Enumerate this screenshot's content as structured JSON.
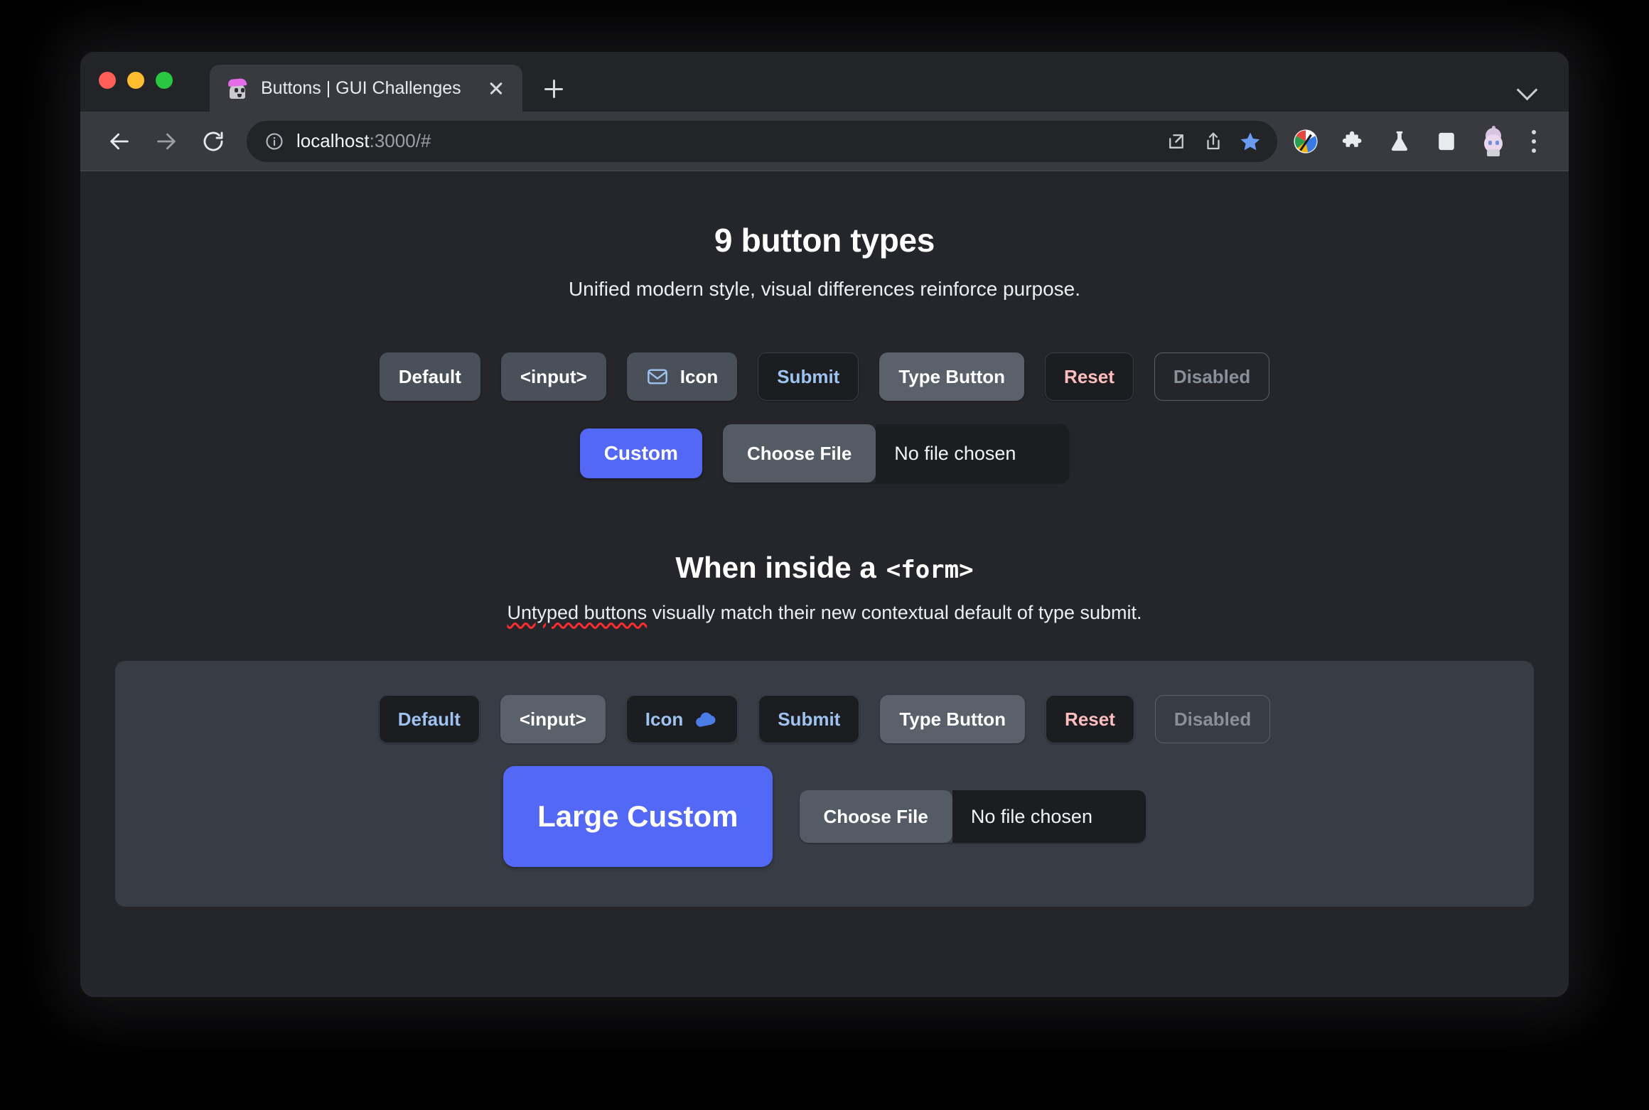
{
  "browser": {
    "tab": {
      "title": "Buttons | GUI Challenges",
      "favicon_name": "ghost-favicon"
    },
    "omnibox": {
      "url_main": "localhost",
      "url_dim": ":3000/#",
      "site_info_icon": "info-circle-icon"
    },
    "toolbar_icons": [
      "back-icon",
      "forward-icon",
      "reload-icon",
      "open-in-new-icon",
      "share-icon",
      "bookmark-star-icon",
      "color-palette-extension-icon",
      "puzzle-extensions-icon",
      "flask-labs-icon",
      "side-panel-icon",
      "profile-avatar-icon",
      "three-dot-menu-icon"
    ],
    "new_tab_label": "+",
    "close_tab_label": "×"
  },
  "page": {
    "title": "9 button types",
    "subtitle": "Unified modern style, visual differences reinforce purpose.",
    "row1": [
      {
        "label": "Default",
        "variant": "default"
      },
      {
        "label": "<input>",
        "variant": "input"
      },
      {
        "label": "Icon",
        "variant": "icon",
        "icon": "mail-envelope-icon",
        "icon_side": "left"
      },
      {
        "label": "Submit",
        "variant": "submit"
      },
      {
        "label": "Type Button",
        "variant": "type"
      },
      {
        "label": "Reset",
        "variant": "reset"
      },
      {
        "label": "Disabled",
        "variant": "disabled"
      }
    ],
    "row2": {
      "custom_label": "Custom",
      "file": {
        "button_label": "Choose File",
        "status_label": "No file chosen"
      }
    },
    "form_section": {
      "title_text": "When inside a",
      "title_mono": "<form>",
      "subtitle_spell": "Untyped buttons",
      "subtitle_rest": " visually match their new contextual default of type submit.",
      "row1": [
        {
          "label": "Default",
          "variant": "default"
        },
        {
          "label": "<input>",
          "variant": "input"
        },
        {
          "label": "Icon",
          "variant": "icon",
          "icon": "cloud-icon",
          "icon_side": "right"
        },
        {
          "label": "Submit",
          "variant": "submit"
        },
        {
          "label": "Type Button",
          "variant": "type"
        },
        {
          "label": "Reset",
          "variant": "reset"
        },
        {
          "label": "Disabled",
          "variant": "disabled"
        }
      ],
      "row2": {
        "custom_label": "Large Custom",
        "file": {
          "button_label": "Choose File",
          "status_label": "No file chosen"
        }
      }
    }
  },
  "colors": {
    "page_bg": "#24262b",
    "form_bg": "#383c45",
    "accent_blue": "#5468f6",
    "submit_text": "#9ec3f0",
    "reset_text": "#ffbdbd",
    "surface": "#4a505a",
    "surface_light": "#5b616b",
    "dark_surface": "#1b1d21",
    "disabled_text": "#8a9099",
    "spellcheck_underline": "#ff2d2d"
  }
}
